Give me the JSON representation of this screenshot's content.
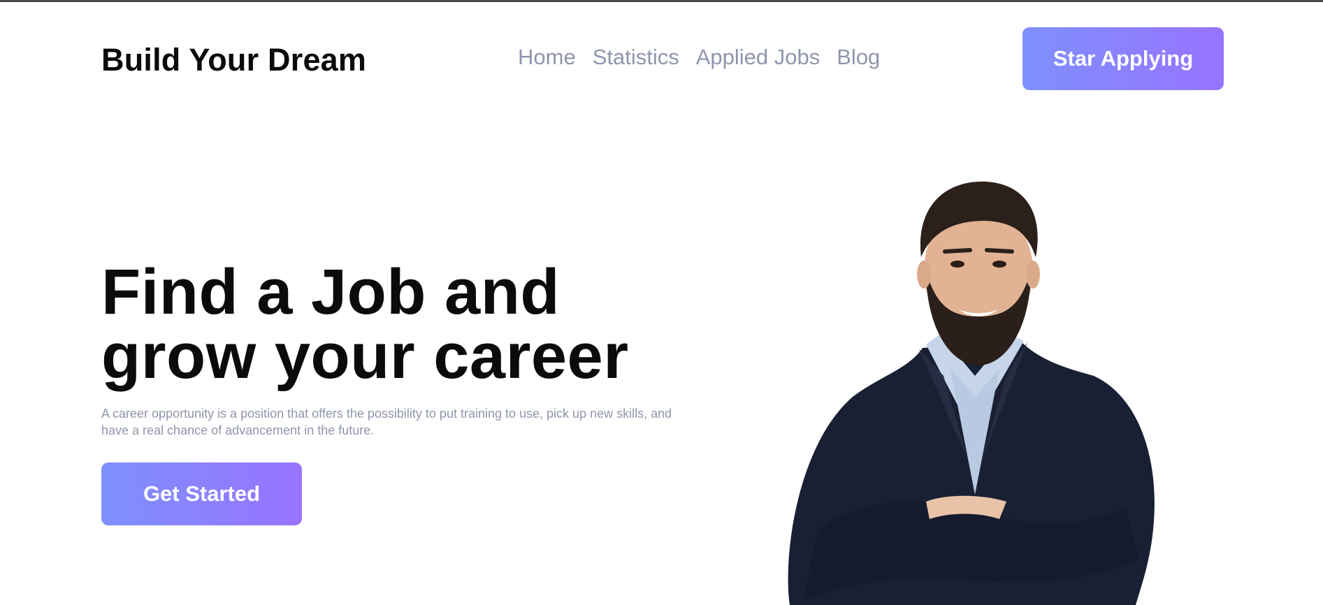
{
  "brand": {
    "title": "Build Your Dream"
  },
  "nav": {
    "items": [
      {
        "label": "Home"
      },
      {
        "label": "Statistics"
      },
      {
        "label": "Applied Jobs"
      },
      {
        "label": "Blog"
      }
    ],
    "cta_label": "Star Applying"
  },
  "hero": {
    "title_line1": "Find a Job and",
    "title_line2": "grow your career",
    "description": "A career opportunity is a position that offers the possibility to put training to use, pick up new skills, and have a real chance of advancement in the future.",
    "cta_label": "Get Started",
    "image": "smiling-man-in-suit-arms-crossed"
  },
  "colors": {
    "gradient_start": "#7E90FE",
    "gradient_end": "#9873FF",
    "nav_text": "#8F96AC",
    "heading_text": "#0B0B0B"
  }
}
